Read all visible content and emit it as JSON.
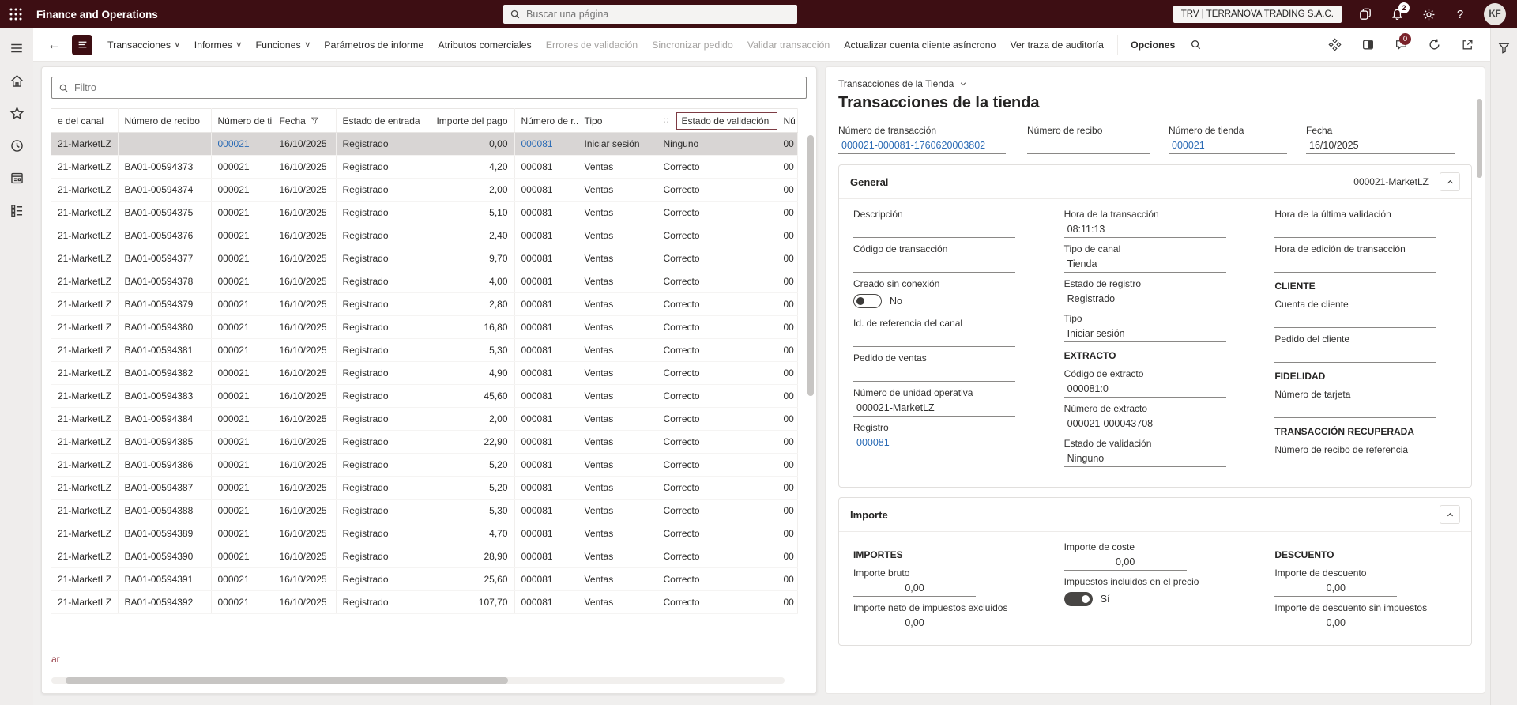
{
  "topbar": {
    "app_title": "Finance and Operations",
    "search_placeholder": "Buscar una página",
    "company": "TRV | TERRANOVA TRADING S.A.C.",
    "notification_count": "2",
    "avatar_initials": "KF",
    "help_glyph": "?"
  },
  "icons": {
    "back_arrow": "←",
    "caret_down": "∨",
    "drag_handle": "∷",
    "more_vertical": "⋮"
  },
  "colors": {
    "topbar": "#3d0e13",
    "link": "#2b6bb5",
    "selected_row": "#d8d5d4",
    "column_highlight_border": "#7d3b43",
    "message_badge": "#7a232b"
  },
  "action_bar": {
    "items": [
      {
        "label": "Transacciones",
        "caret": true
      },
      {
        "label": "Informes",
        "caret": true
      },
      {
        "label": "Funciones",
        "caret": true
      },
      {
        "label": "Parámetros de informe"
      },
      {
        "label": "Atributos comerciales"
      },
      {
        "label": "Errores de validación",
        "disabled": true
      },
      {
        "label": "Sincronizar pedido",
        "disabled": true
      },
      {
        "label": "Validar transacción",
        "disabled": true
      },
      {
        "label": "Actualizar cuenta cliente asíncrono"
      },
      {
        "label": "Ver traza de auditoría"
      },
      {
        "label": "Opciones",
        "bold": true
      }
    ],
    "message_badge": "0"
  },
  "grid": {
    "filter_placeholder": "Filtro",
    "footer_link": "ar",
    "columns": [
      {
        "label": "e del canal"
      },
      {
        "label": "Número de recibo"
      },
      {
        "label": "Número de ti..."
      },
      {
        "label": "Fecha"
      },
      {
        "label": "Estado de entrada"
      },
      {
        "label": "Importe del pago"
      },
      {
        "label": "Número de r..."
      },
      {
        "label": "Tipo"
      },
      {
        "label": "Estado de validación"
      },
      {
        "label": "Nú"
      }
    ],
    "rows": [
      {
        "canal": "21-MarketLZ",
        "recibo": "",
        "tienda": "000021",
        "fecha": "16/10/2025",
        "estado": "Registrado",
        "importe": "0,00",
        "numero_r": "000081",
        "tipo": "Iniciar sesión",
        "validacion": "Ninguno",
        "nu": "00",
        "selected": true,
        "links": true
      },
      {
        "canal": "21-MarketLZ",
        "recibo": "BA01-00594373",
        "tienda": "000021",
        "fecha": "16/10/2025",
        "estado": "Registrado",
        "importe": "4,20",
        "numero_r": "000081",
        "tipo": "Ventas",
        "validacion": "Correcto",
        "nu": "00"
      },
      {
        "canal": "21-MarketLZ",
        "recibo": "BA01-00594374",
        "tienda": "000021",
        "fecha": "16/10/2025",
        "estado": "Registrado",
        "importe": "2,00",
        "numero_r": "000081",
        "tipo": "Ventas",
        "validacion": "Correcto",
        "nu": "00"
      },
      {
        "canal": "21-MarketLZ",
        "recibo": "BA01-00594375",
        "tienda": "000021",
        "fecha": "16/10/2025",
        "estado": "Registrado",
        "importe": "5,10",
        "numero_r": "000081",
        "tipo": "Ventas",
        "validacion": "Correcto",
        "nu": "00"
      },
      {
        "canal": "21-MarketLZ",
        "recibo": "BA01-00594376",
        "tienda": "000021",
        "fecha": "16/10/2025",
        "estado": "Registrado",
        "importe": "2,40",
        "numero_r": "000081",
        "tipo": "Ventas",
        "validacion": "Correcto",
        "nu": "00"
      },
      {
        "canal": "21-MarketLZ",
        "recibo": "BA01-00594377",
        "tienda": "000021",
        "fecha": "16/10/2025",
        "estado": "Registrado",
        "importe": "9,70",
        "numero_r": "000081",
        "tipo": "Ventas",
        "validacion": "Correcto",
        "nu": "00"
      },
      {
        "canal": "21-MarketLZ",
        "recibo": "BA01-00594378",
        "tienda": "000021",
        "fecha": "16/10/2025",
        "estado": "Registrado",
        "importe": "4,00",
        "numero_r": "000081",
        "tipo": "Ventas",
        "validacion": "Correcto",
        "nu": "00"
      },
      {
        "canal": "21-MarketLZ",
        "recibo": "BA01-00594379",
        "tienda": "000021",
        "fecha": "16/10/2025",
        "estado": "Registrado",
        "importe": "2,80",
        "numero_r": "000081",
        "tipo": "Ventas",
        "validacion": "Correcto",
        "nu": "00"
      },
      {
        "canal": "21-MarketLZ",
        "recibo": "BA01-00594380",
        "tienda": "000021",
        "fecha": "16/10/2025",
        "estado": "Registrado",
        "importe": "16,80",
        "numero_r": "000081",
        "tipo": "Ventas",
        "validacion": "Correcto",
        "nu": "00"
      },
      {
        "canal": "21-MarketLZ",
        "recibo": "BA01-00594381",
        "tienda": "000021",
        "fecha": "16/10/2025",
        "estado": "Registrado",
        "importe": "5,30",
        "numero_r": "000081",
        "tipo": "Ventas",
        "validacion": "Correcto",
        "nu": "00"
      },
      {
        "canal": "21-MarketLZ",
        "recibo": "BA01-00594382",
        "tienda": "000021",
        "fecha": "16/10/2025",
        "estado": "Registrado",
        "importe": "4,90",
        "numero_r": "000081",
        "tipo": "Ventas",
        "validacion": "Correcto",
        "nu": "00"
      },
      {
        "canal": "21-MarketLZ",
        "recibo": "BA01-00594383",
        "tienda": "000021",
        "fecha": "16/10/2025",
        "estado": "Registrado",
        "importe": "45,60",
        "numero_r": "000081",
        "tipo": "Ventas",
        "validacion": "Correcto",
        "nu": "00"
      },
      {
        "canal": "21-MarketLZ",
        "recibo": "BA01-00594384",
        "tienda": "000021",
        "fecha": "16/10/2025",
        "estado": "Registrado",
        "importe": "2,00",
        "numero_r": "000081",
        "tipo": "Ventas",
        "validacion": "Correcto",
        "nu": "00"
      },
      {
        "canal": "21-MarketLZ",
        "recibo": "BA01-00594385",
        "tienda": "000021",
        "fecha": "16/10/2025",
        "estado": "Registrado",
        "importe": "22,90",
        "numero_r": "000081",
        "tipo": "Ventas",
        "validacion": "Correcto",
        "nu": "00"
      },
      {
        "canal": "21-MarketLZ",
        "recibo": "BA01-00594386",
        "tienda": "000021",
        "fecha": "16/10/2025",
        "estado": "Registrado",
        "importe": "5,20",
        "numero_r": "000081",
        "tipo": "Ventas",
        "validacion": "Correcto",
        "nu": "00"
      },
      {
        "canal": "21-MarketLZ",
        "recibo": "BA01-00594387",
        "tienda": "000021",
        "fecha": "16/10/2025",
        "estado": "Registrado",
        "importe": "5,20",
        "numero_r": "000081",
        "tipo": "Ventas",
        "validacion": "Correcto",
        "nu": "00"
      },
      {
        "canal": "21-MarketLZ",
        "recibo": "BA01-00594388",
        "tienda": "000021",
        "fecha": "16/10/2025",
        "estado": "Registrado",
        "importe": "5,30",
        "numero_r": "000081",
        "tipo": "Ventas",
        "validacion": "Correcto",
        "nu": "00"
      },
      {
        "canal": "21-MarketLZ",
        "recibo": "BA01-00594389",
        "tienda": "000021",
        "fecha": "16/10/2025",
        "estado": "Registrado",
        "importe": "4,70",
        "numero_r": "000081",
        "tipo": "Ventas",
        "validacion": "Correcto",
        "nu": "00"
      },
      {
        "canal": "21-MarketLZ",
        "recibo": "BA01-00594390",
        "tienda": "000021",
        "fecha": "16/10/2025",
        "estado": "Registrado",
        "importe": "28,90",
        "numero_r": "000081",
        "tipo": "Ventas",
        "validacion": "Correcto",
        "nu": "00"
      },
      {
        "canal": "21-MarketLZ",
        "recibo": "BA01-00594391",
        "tienda": "000021",
        "fecha": "16/10/2025",
        "estado": "Registrado",
        "importe": "25,60",
        "numero_r": "000081",
        "tipo": "Ventas",
        "validacion": "Correcto",
        "nu": "00"
      },
      {
        "canal": "21-MarketLZ",
        "recibo": "BA01-00594392",
        "tienda": "000021",
        "fecha": "16/10/2025",
        "estado": "Registrado",
        "importe": "107,70",
        "numero_r": "000081",
        "tipo": "Ventas",
        "validacion": "Correcto",
        "nu": "00"
      }
    ]
  },
  "panel": {
    "breadcrumb": "Transacciones de la Tienda",
    "title": "Transacciones de la tienda",
    "header_fields": [
      {
        "label": "Número de transacción",
        "value": "000021-000081-1760620003802",
        "link": true
      },
      {
        "label": "Número de recibo",
        "value": ""
      },
      {
        "label": "Número de tienda",
        "value": "000021",
        "link": true
      },
      {
        "label": "Fecha",
        "value": "16/10/2025"
      }
    ],
    "general": {
      "title": "General",
      "subtitle": "000021-MarketLZ",
      "col1": [
        {
          "label": "Descripción",
          "value": ""
        },
        {
          "label": "Código de transacción",
          "value": ""
        },
        {
          "label": "Creado sin conexión",
          "type": "toggle",
          "value": "No",
          "on": false
        },
        {
          "label": "Id. de referencia del canal",
          "value": ""
        },
        {
          "label": "Pedido de ventas",
          "value": ""
        },
        {
          "label": "Número de unidad operativa",
          "value": "000021-MarketLZ"
        },
        {
          "label": "Registro",
          "value": "000081",
          "link": true
        }
      ],
      "col2": [
        {
          "label": "Hora de la transacción",
          "value": "08:11:13"
        },
        {
          "label": "Tipo de canal",
          "value": "Tienda"
        },
        {
          "label": "Estado de registro",
          "value": "Registrado"
        },
        {
          "label": "Tipo",
          "value": "Iniciar sesión"
        },
        {
          "group": "EXTRACTO"
        },
        {
          "label": "Código de extracto",
          "value": "000081:0"
        },
        {
          "label": "Número de extracto",
          "value": "000021-000043708"
        },
        {
          "label": "Estado de validación",
          "value": "Ninguno"
        }
      ],
      "col3": [
        {
          "label": "Hora de la última validación",
          "value": ""
        },
        {
          "label": "Hora de edición de transacción",
          "value": ""
        },
        {
          "group": "CLIENTE"
        },
        {
          "label": "Cuenta de cliente",
          "value": ""
        },
        {
          "label": "Pedido del cliente",
          "value": ""
        },
        {
          "group": "FIDELIDAD"
        },
        {
          "label": "Número de tarjeta",
          "value": ""
        },
        {
          "group": "TRANSACCIÓN RECUPERADA"
        },
        {
          "label": "Número de recibo de referencia",
          "value": ""
        }
      ]
    },
    "importe": {
      "title": "Importe",
      "col1": [
        {
          "group": "IMPORTES"
        },
        {
          "label": "Importe bruto",
          "value": "0,00",
          "num": true
        },
        {
          "label": "Importe neto de impuestos excluidos",
          "value": "0,00",
          "num": true
        }
      ],
      "col2": [
        {
          "label": "Importe de coste",
          "value": "0,00",
          "num": true
        },
        {
          "label": "Impuestos incluidos en el precio",
          "type": "toggle",
          "value": "Sí",
          "on": true
        }
      ],
      "col3": [
        {
          "group": "DESCUENTO"
        },
        {
          "label": "Importe de descuento",
          "value": "0,00",
          "num": true
        },
        {
          "label": "Importe de descuento sin impuestos",
          "value": "0,00",
          "num": true
        }
      ]
    }
  }
}
